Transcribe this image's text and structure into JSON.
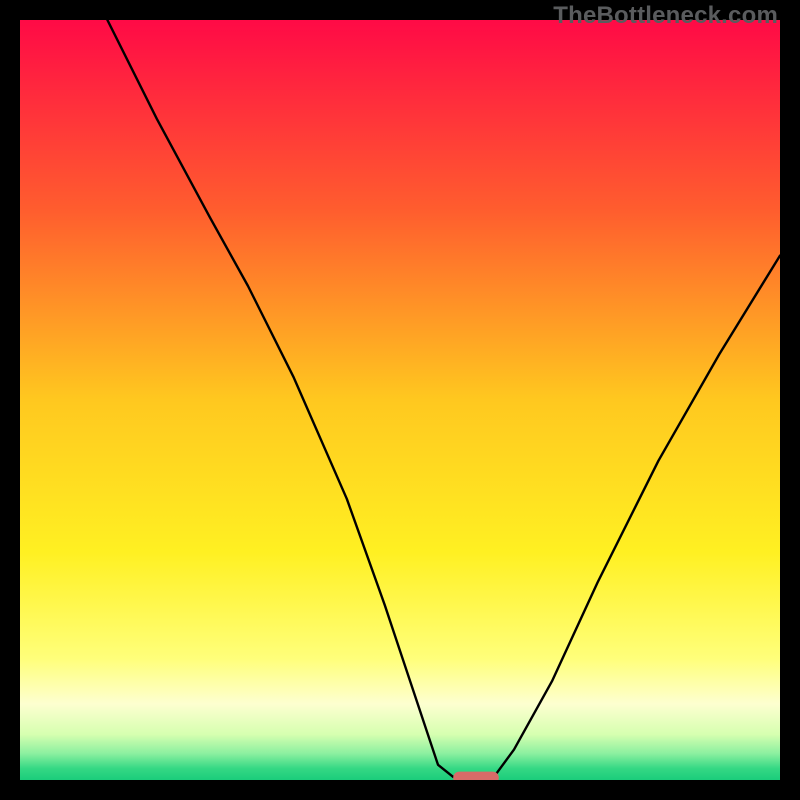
{
  "watermark": "TheBottleneck.com",
  "chart_data": {
    "type": "line",
    "title": "",
    "xlabel": "",
    "ylabel": "",
    "xlim": [
      0,
      100
    ],
    "ylim": [
      0,
      100
    ],
    "gradient_stops": [
      {
        "offset": 0,
        "color": "#ff0a46"
      },
      {
        "offset": 0.25,
        "color": "#ff5d2e"
      },
      {
        "offset": 0.5,
        "color": "#ffc81f"
      },
      {
        "offset": 0.7,
        "color": "#fff022"
      },
      {
        "offset": 0.84,
        "color": "#ffff7a"
      },
      {
        "offset": 0.9,
        "color": "#fdffd0"
      },
      {
        "offset": 0.94,
        "color": "#d6ffb0"
      },
      {
        "offset": 0.965,
        "color": "#8cf0a0"
      },
      {
        "offset": 0.985,
        "color": "#34d884"
      },
      {
        "offset": 1,
        "color": "#1bcd7b"
      }
    ],
    "series": [
      {
        "name": "bottleneck-curve",
        "stroke": "#000000",
        "stroke_width": 2.4,
        "x": [
          11.5,
          18,
          25,
          30,
          36,
          43,
          48,
          52,
          55,
          57,
          57.5,
          62,
          62.5,
          65,
          70,
          76,
          84,
          92,
          100
        ],
        "y": [
          100,
          87,
          74,
          65,
          53,
          37,
          23,
          11,
          2,
          0.4,
          0.3,
          0.3,
          0.6,
          4,
          13,
          26,
          42,
          56,
          69
        ]
      }
    ],
    "marker": {
      "name": "optimal-pill",
      "cx": 60,
      "cy": 0.3,
      "width": 6,
      "height": 1.6,
      "fill": "#d86b68"
    }
  }
}
